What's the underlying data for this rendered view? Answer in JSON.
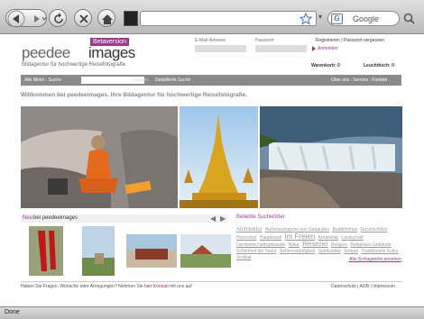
{
  "browser": {
    "url": "",
    "search_placeholder": "Google",
    "status": "Done"
  },
  "site": {
    "logo_main": "peedee",
    "logo_images": "images",
    "beta_label": "Betaversion",
    "tagline": "Bildagentur für hochwertige Reisefotografie."
  },
  "login": {
    "email_label": "E-Mail-Adresse",
    "password_label": "Passwort",
    "register_link": "Registrieren | Passwort vergessen",
    "login_link": "Anmelden",
    "cart_label": "Warenkorb: 0",
    "lightbox_label": "Leuchttisch: 0"
  },
  "nav": {
    "search_scope": "Alle Bilder : Suche",
    "search_button": "Suchen",
    "advanced_search": "Detaillierte Suche",
    "right_links": "Über uns : Service : Kontakt"
  },
  "welcome": "Willkommen bei peedeeimages. Ihre Bildagentur für hochwertige Reisefotografie.",
  "new_section": {
    "new_word": "Neu",
    "title_rest": "bei peedeeimages"
  },
  "popular": {
    "title": "Beliebte Suchwörter",
    "tags": [
      "Architektur",
      "Außenaufnahme von Gebäuden",
      "Buddhismus",
      "Geschichtlich",
      "Horizontal",
      "Hauptstadt",
      "Im Freien",
      "Kreativität",
      "Landschaft",
      "Landwirtschaftsgebäude",
      "Natur",
      "Reiseziel",
      "Religion",
      "Religiöses Gebäude",
      "Schönheit der Natur",
      "Sehenswürdigkeit",
      "Spiritualität",
      "Tempel",
      "Traditionelle Kultur",
      "Vertikal"
    ],
    "all_link": "Alle Schlagworte ansehen"
  },
  "footer": {
    "contact_text_a": "Haben Sie Fragen, Wünsche oder Anregungen? Nehmen Sie hier",
    "contact_link": "Kontakt",
    "contact_text_b": "mit uns auf",
    "links": "Datenschutz | AGB | Impressum"
  },
  "colors": {
    "brand_purple": "#9c3b8e",
    "nav_grey": "#8a8a8a"
  },
  "icons": [
    "back-icon",
    "forward-icon",
    "reload-icon",
    "stop-icon",
    "home-icon",
    "bookmark-star-icon",
    "google-icon",
    "search-icon"
  ]
}
